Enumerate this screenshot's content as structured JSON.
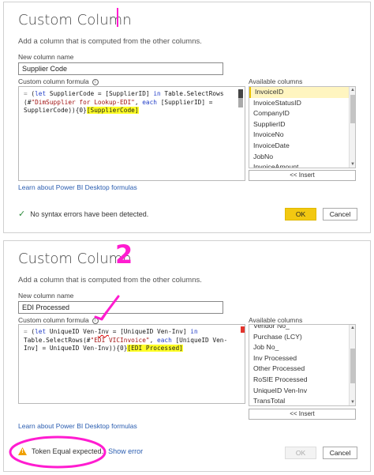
{
  "dialog1": {
    "title": "Custom Column",
    "subtitle": "Add a column that is computed from the other columns.",
    "new_column_name_label": "New column name",
    "new_column_name_value": "Supplier Code",
    "formula_label": "Custom column formula",
    "available_label": "Available columns",
    "available_items": [
      "InvoiceID",
      "InvoiceStatusID",
      "CompanyID",
      "SupplierID",
      "InvoiceNo",
      "InvoiceDate",
      "JobNo",
      "InvoiceAmount"
    ],
    "insert_label": "<< Insert",
    "learn_link": "Learn about Power BI Desktop formulas",
    "status_text": "No syntax errors have been detected.",
    "ok_label": "OK",
    "cancel_label": "Cancel"
  },
  "dialog2": {
    "title": "Custom Column",
    "subtitle": "Add a column that is computed from the other columns.",
    "new_column_name_label": "New column name",
    "new_column_name_value": "EDI Processed",
    "formula_label": "Custom column formula",
    "available_label": "Available columns",
    "available_items": [
      "Vendor No_",
      "Purchase (LCY)",
      "Job No_",
      "Inv Processed",
      "Other Processed",
      "RoSIE Processed",
      "UniqueID Ven-Inv",
      "TransTotal"
    ],
    "insert_label": "<< Insert",
    "learn_link": "Learn about Power BI Desktop formulas",
    "status_text": "Token Equal expected.",
    "show_error_label": "Show error",
    "ok_label": "OK",
    "cancel_label": "Cancel"
  },
  "annotations": {
    "number_two": "2"
  },
  "colors": {
    "accent_yellow": "#f2c811",
    "highlight": "#ffff26",
    "annotation_magenta": "#ff1cd0",
    "keyword_blue": "#2540c8",
    "string_red": "#a31515"
  }
}
